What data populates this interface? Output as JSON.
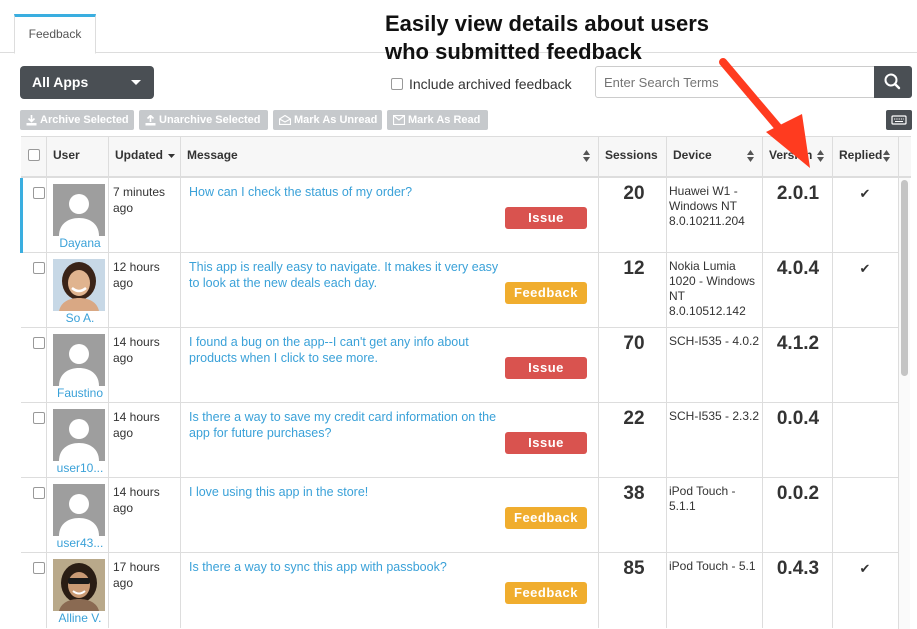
{
  "tabs": [
    {
      "label": "Feedback"
    }
  ],
  "callout": {
    "line1": "Easily view details about users",
    "line2": "who submitted feedback"
  },
  "toolbar": {
    "apps_label": "All Apps",
    "include_archived_label": "Include archived feedback",
    "search_placeholder": "Enter Search Terms",
    "archive_selected": "Archive Selected",
    "unarchive_selected": "Unarchive Selected",
    "mark_unread": "Mark As Unread",
    "mark_read": "Mark As Read"
  },
  "columns": {
    "user": "User",
    "updated": "Updated",
    "message": "Message",
    "sessions": "Sessions",
    "device": "Device",
    "version": "Version",
    "replied": "Replied"
  },
  "rows": [
    {
      "user": "Dayana",
      "updated": "7 minutes ago",
      "message": "How can I check the status of my order?",
      "type": "Issue",
      "sessions": "20",
      "device": "Huawei W1 - Windows NT 8.0.10211.204",
      "version": "2.0.1",
      "replied": "✔"
    },
    {
      "user": "So A.",
      "updated": "12 hours ago",
      "message": "This app is really easy to navigate. It makes it very easy to look at the new deals each day.",
      "type": "Feedback",
      "sessions": "12",
      "device": "Nokia Lumia 1020 - Windows NT 8.0.10512.142",
      "version": "4.0.4",
      "replied": "✔"
    },
    {
      "user": "Faustino",
      "updated": "14 hours ago",
      "message": "I found a bug on the app--I can't get any info about products when I click to see more.",
      "type": "Issue",
      "sessions": "70",
      "device": "SCH-I535 - 4.0.2",
      "version": "4.1.2",
      "replied": ""
    },
    {
      "user": "user10...",
      "updated": "14 hours ago",
      "message": "Is there a way to save my credit card information on the app for future purchases?",
      "type": "Issue",
      "sessions": "22",
      "device": "SCH-I535 - 2.3.2",
      "version": "0.0.4",
      "replied": ""
    },
    {
      "user": "user43...",
      "updated": "14 hours ago",
      "message": "I love using this app in the store!",
      "type": "Feedback",
      "sessions": "38",
      "device": "iPod Touch - 5.1.1",
      "version": "0.0.2",
      "replied": ""
    },
    {
      "user": "Alline V.",
      "updated": "17 hours ago",
      "message": "Is there a way to sync this app with passbook?",
      "type": "Feedback",
      "sessions": "85",
      "device": "iPod Touch - 5.1",
      "version": "0.4.3",
      "replied": "✔"
    }
  ],
  "colors": {
    "issue": "#d9534f",
    "feedback": "#f0ad2e",
    "link": "#3aa1d8",
    "accent": "#3aaee0",
    "arrow": "#ff3b1f"
  }
}
